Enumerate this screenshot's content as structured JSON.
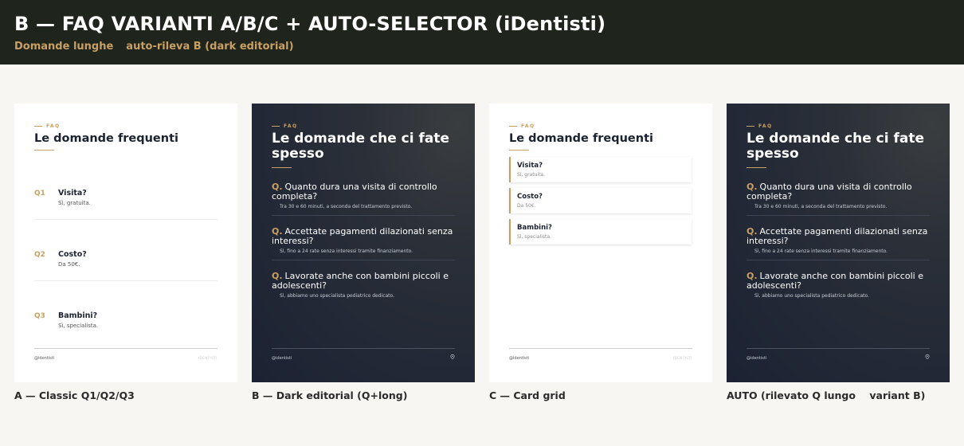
{
  "header": {
    "title": "B — FAQ VARIANTI A/B/C + AUTO-SELECTOR (iDentisti)",
    "subtitle_left": "Domande lunghe",
    "subtitle_right": "auto-rileva B (dark editorial)"
  },
  "colors": {
    "header_bg": "#1f241c",
    "accent_gold": "#c9a063",
    "dark_navy": "#1b2233",
    "page_bg": "#f8f6f2"
  },
  "variant_a": {
    "caption": "A — Classic Q1/Q2/Q3",
    "eyebrow": "FAQ",
    "title": "Le domande frequenti",
    "items": [
      {
        "num": "Q1",
        "question": "Visita?",
        "answer": "Sì, gratuita."
      },
      {
        "num": "Q2",
        "question": "Costo?",
        "answer": "Da 50€."
      },
      {
        "num": "Q3",
        "question": "Bambini?",
        "answer": "Sì, specialista."
      }
    ],
    "footer_brand": "@identisti",
    "footer_meta": "IDENTISTI"
  },
  "variant_b": {
    "caption": "B — Dark editorial (Q+long)",
    "eyebrow": "FAQ",
    "title": "Le domande che ci fate spesso",
    "q_prefix": "Q.",
    "items": [
      {
        "question": "Quanto dura una visita di controllo completa?",
        "answer": "Tra 30 e 60 minuti, a seconda del trattamento previsto."
      },
      {
        "question": "Accettate pagamenti dilazionati senza interessi?",
        "answer": "Sì, fino a 24 rate senza interessi tramite finanziamento."
      },
      {
        "question": "Lavorate anche con bambini piccoli e adolescenti?",
        "answer": "Sì, abbiamo uno specialista pediatrico dedicato."
      }
    ],
    "footer_brand": "@identisti",
    "footer_icon": "map-pin-icon"
  },
  "variant_c": {
    "caption": "C — Card grid",
    "eyebrow": "FAQ",
    "title": "Le domande frequenti",
    "items": [
      {
        "question": "Visita?",
        "answer": "Sì, gratuita."
      },
      {
        "question": "Costo?",
        "answer": "Da 50€."
      },
      {
        "question": "Bambini?",
        "answer": "Sì, specialista."
      }
    ],
    "footer_brand": "@identisti",
    "footer_meta": "IDENTISTI"
  },
  "variant_auto": {
    "caption": "AUTO (rilevato Q lungo    variant B)",
    "eyebrow": "FAQ",
    "title": "Le domande che ci fate spesso",
    "q_prefix": "Q.",
    "items": [
      {
        "question": "Quanto dura una visita di controllo completa?",
        "answer": "Tra 30 e 60 minuti, a seconda del trattamento previsto."
      },
      {
        "question": "Accettate pagamenti dilazionati senza interessi?",
        "answer": "Sì, fino a 24 rate senza interessi tramite finanziamento."
      },
      {
        "question": "Lavorate anche con bambini piccoli e adolescenti?",
        "answer": "Sì, abbiamo uno specialista pediatrico dedicato."
      }
    ],
    "footer_brand": "@identisti",
    "footer_icon": "map-pin-icon"
  }
}
